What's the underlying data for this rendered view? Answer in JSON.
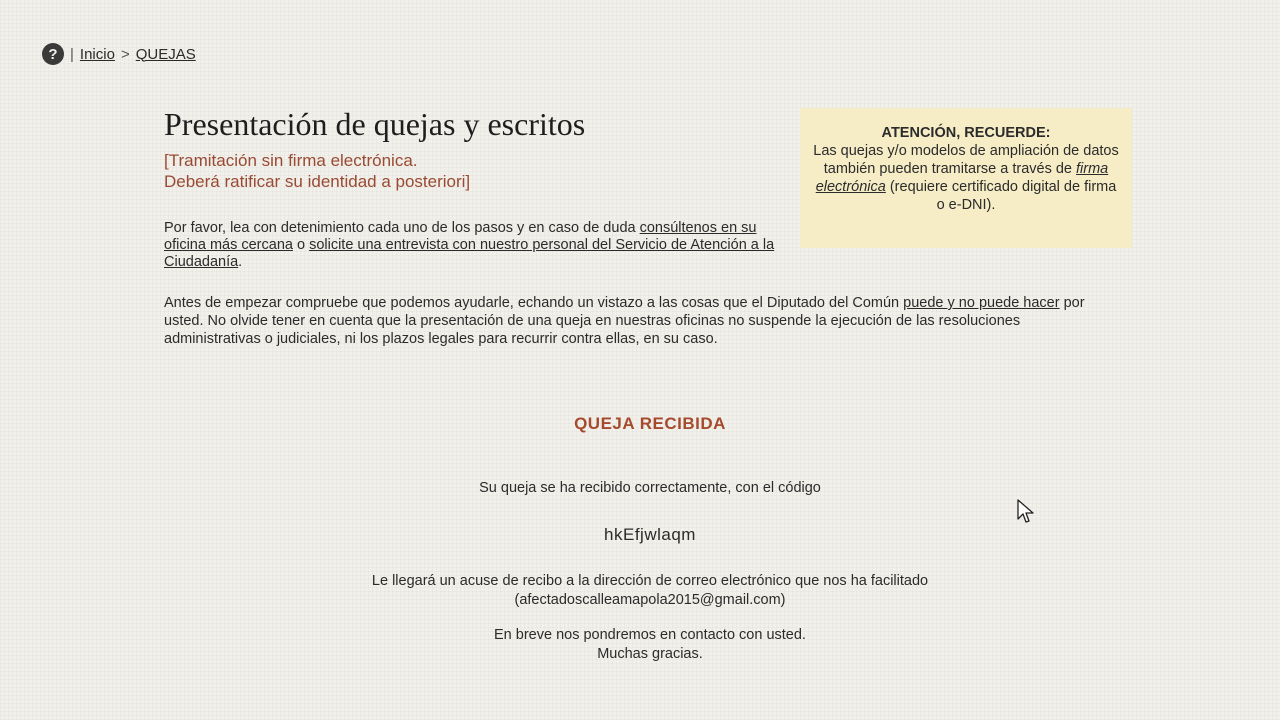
{
  "breadcrumb": {
    "help_icon": "?",
    "home": "Inicio",
    "separator": ">",
    "current": "QUEJAS"
  },
  "header": {
    "title": "Presentación de quejas y escritos",
    "subtitle_line1": "[Tramitación sin firma electrónica.",
    "subtitle_line2": "Deberá ratificar su identidad a posteriori]"
  },
  "intro": {
    "text1": "Por favor, lea con detenimiento cada uno de los pasos y en caso de duda ",
    "link1": "consúltenos en su oficina más cercana",
    "text2": " o ",
    "link2": "solicite una entrevista con nuestro personal del Servicio de Atención a la Ciudadanía",
    "text3": ".",
    "p2_text1": "Antes de empezar compruebe que podemos ayudarle, echando un vistazo a las cosas que el Diputado del Común ",
    "p2_link": "puede y no puede hacer",
    "p2_text2": " por usted. No olvide tener en cuenta que la presentación de una queja en nuestras oficinas no suspende la ejecución de las resoluciones administrativas o judiciales, ni los plazos legales para recurrir contra ellas, en su caso."
  },
  "notice": {
    "title": "ATENCIÓN, RECUERDE:",
    "text1": "Las quejas y/o modelos de ampliación de datos también pueden tramitarse a través de ",
    "link": "firma electrónica",
    "text2": " (requiere certificado digital de firma o e-DNI)."
  },
  "confirmation": {
    "title": "QUEJA RECIBIDA",
    "received_text": "Su queja se ha recibido correctamente, con el código",
    "code": "hkEfjwlaqm",
    "email_text": "Le llegará un acuse de recibo a la dirección de correo electrónico que nos ha facilitado",
    "email": "(afectadoscalleamapola2015@gmail.com)",
    "contact_text": "En breve nos pondremos en contacto con usted.",
    "thanks": "Muchas gracias."
  },
  "colors": {
    "accent": "#a64a2e",
    "notice_bg": "#f6edc6",
    "background": "#f1f0ea"
  },
  "icons": [
    "help-icon",
    "mouse-cursor-icon"
  ]
}
